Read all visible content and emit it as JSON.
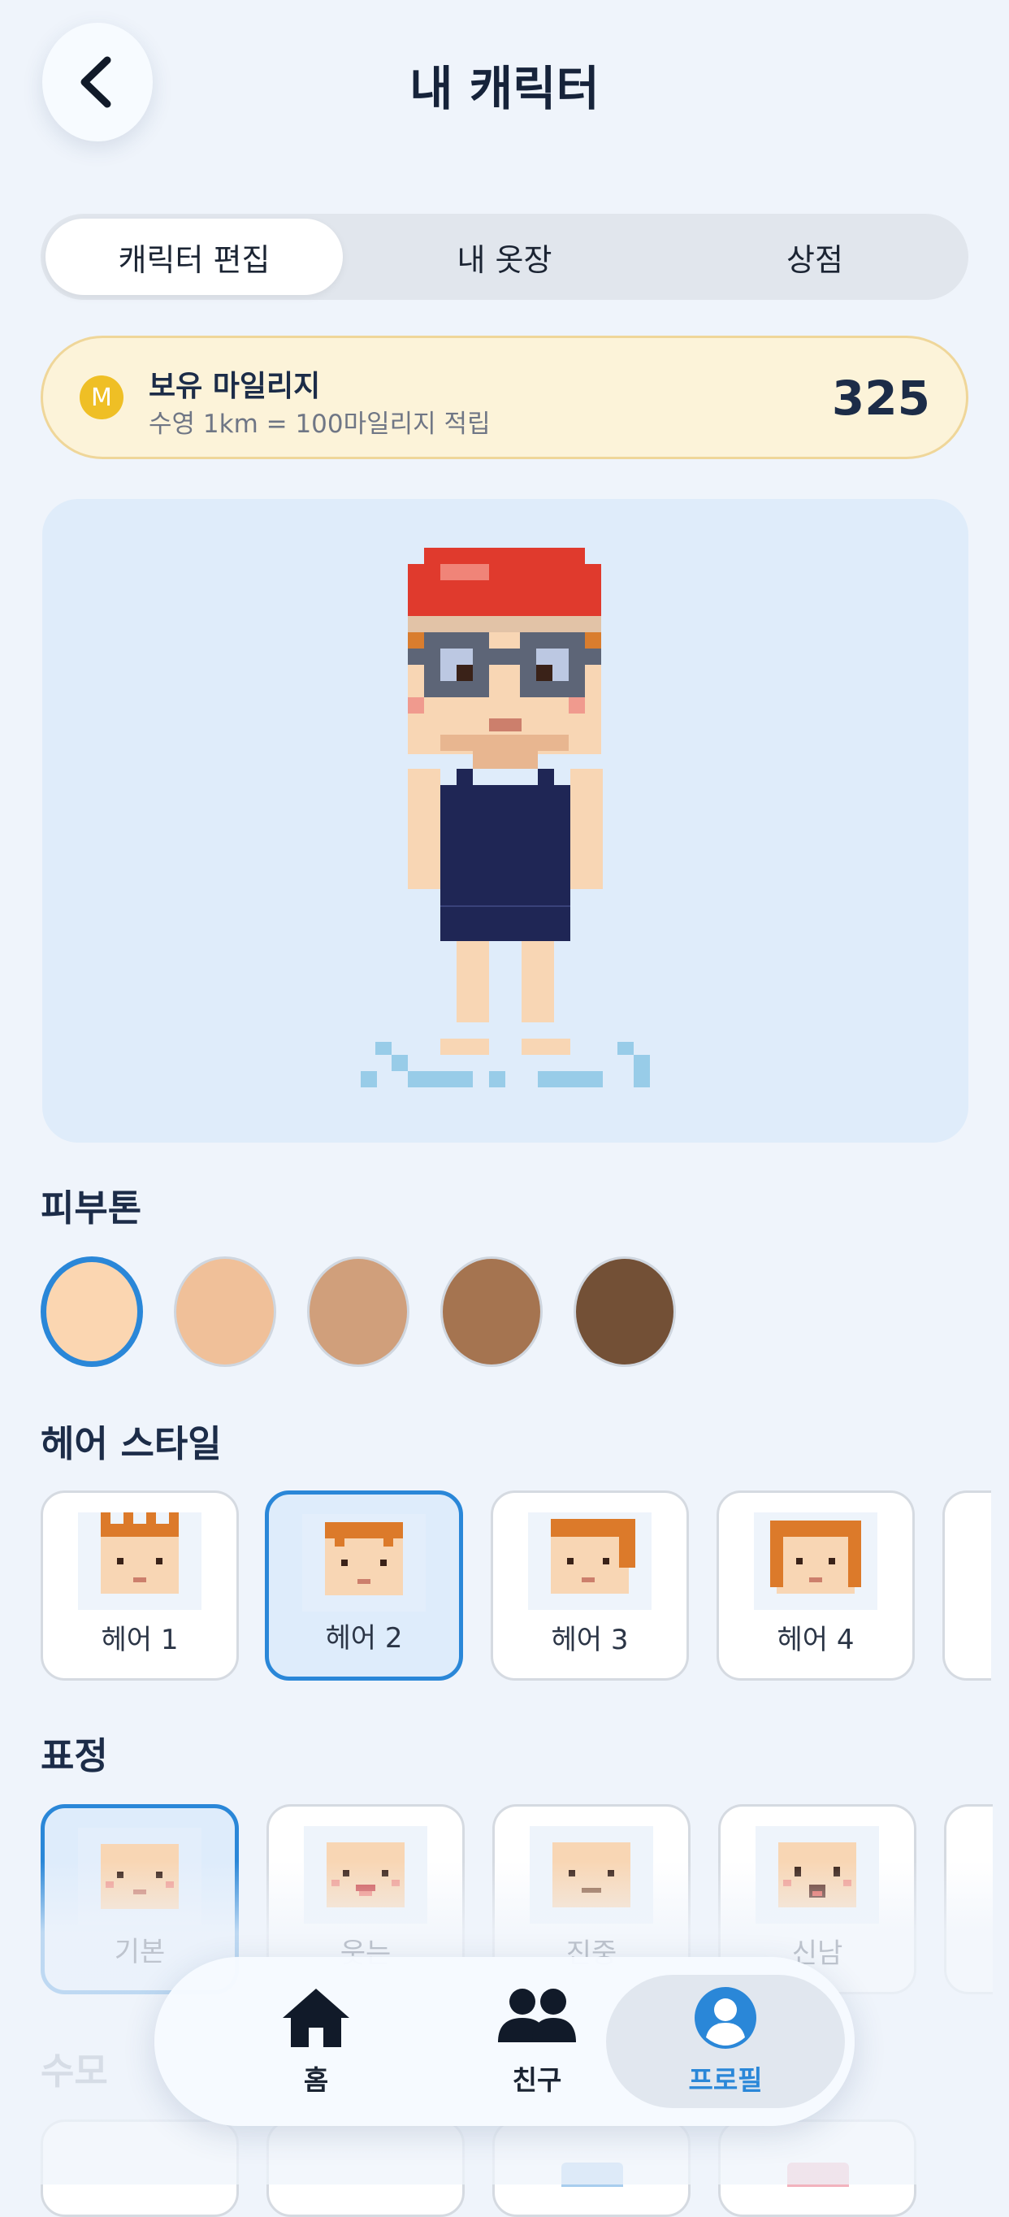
{
  "header": {
    "title": "내 캐릭터",
    "back_icon": "chevron-left-icon"
  },
  "tabs": [
    {
      "label": "캐릭터 편집",
      "active": true
    },
    {
      "label": "내 옷장",
      "active": false
    },
    {
      "label": "상점",
      "active": false
    }
  ],
  "mileage": {
    "coin_symbol": "M",
    "title": "보유 마일리지",
    "subtitle": "수영 1km = 100마일리지 적립",
    "value": "325"
  },
  "skin": {
    "title": "피부톤",
    "swatches": [
      {
        "color": "#fbd6b1",
        "selected": true
      },
      {
        "color": "#f0c099",
        "selected": false
      },
      {
        "color": "#d09f7b",
        "selected": false
      },
      {
        "color": "#a57450",
        "selected": false
      },
      {
        "color": "#735036",
        "selected": false
      }
    ]
  },
  "hair": {
    "title": "헤어 스타일",
    "items": [
      {
        "label": "헤어 1",
        "selected": false
      },
      {
        "label": "헤어 2",
        "selected": true
      },
      {
        "label": "헤어 3",
        "selected": false
      },
      {
        "label": "헤어 4",
        "selected": false
      }
    ]
  },
  "expression": {
    "title": "표정",
    "items": [
      {
        "label": "기본",
        "selected": true
      },
      {
        "label": "웃는",
        "selected": false
      },
      {
        "label": "진중",
        "selected": false
      },
      {
        "label": "신남",
        "selected": false
      }
    ]
  },
  "swimsuit": {
    "title": "수모"
  },
  "nav": [
    {
      "label": "홈",
      "icon": "home-icon",
      "active": false
    },
    {
      "label": "친구",
      "icon": "friends-icon",
      "active": false
    },
    {
      "label": "프로필",
      "icon": "profile-icon",
      "active": true
    }
  ],
  "colors": {
    "accent": "#2a87d8",
    "cap": "#e03a2d",
    "suit": "#1f2655",
    "skin": "#f8d6b4"
  }
}
